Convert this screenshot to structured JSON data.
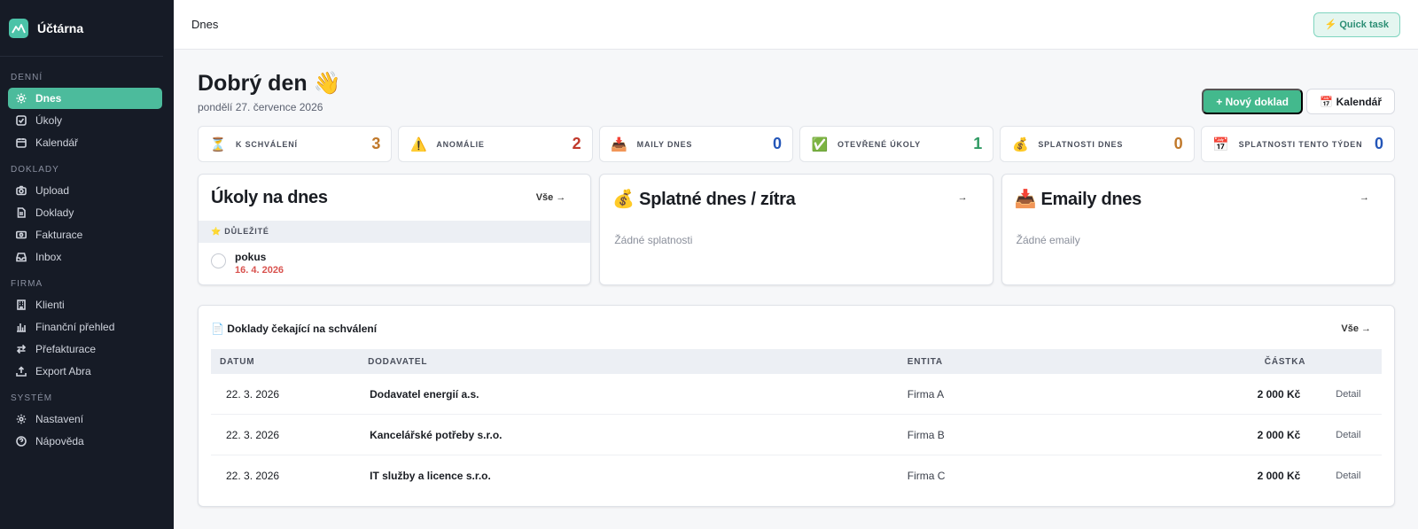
{
  "brand": {
    "name": "Účtárna",
    "color": "#4cc3a8"
  },
  "sidebar": {
    "sections": [
      {
        "title": "DENNÍ",
        "items": [
          {
            "label": "Dnes",
            "icon": "sun-icon",
            "active": true
          },
          {
            "label": "Úkoly",
            "icon": "checkbox-icon"
          },
          {
            "label": "Kalendář",
            "icon": "calendar-icon"
          }
        ]
      },
      {
        "title": "DOKLADY",
        "items": [
          {
            "label": "Upload",
            "icon": "camera-icon"
          },
          {
            "label": "Doklady",
            "icon": "document-icon"
          },
          {
            "label": "Fakturace",
            "icon": "banknote-icon"
          },
          {
            "label": "Inbox",
            "icon": "inbox-icon"
          }
        ]
      },
      {
        "title": "FIRMA",
        "items": [
          {
            "label": "Klienti",
            "icon": "building-icon"
          },
          {
            "label": "Finanční přehled",
            "icon": "bar-chart-icon"
          },
          {
            "label": "Přefakturace",
            "icon": "swap-icon"
          },
          {
            "label": "Export Abra",
            "icon": "upload-icon"
          }
        ]
      },
      {
        "title": "SYSTÉM",
        "items": [
          {
            "label": "Nastavení",
            "icon": "gear-icon"
          },
          {
            "label": "Nápověda",
            "icon": "help-icon"
          }
        ]
      }
    ]
  },
  "topbar": {
    "crumb": "Dnes",
    "quick_task": "⚡ Quick task"
  },
  "greeting": {
    "title": "Dobrý den 👋",
    "date": "pondělí 27. července 2026"
  },
  "actions": {
    "new_doc": "+ Nový doklad",
    "calendar": "📅 Kalendář"
  },
  "stats": [
    {
      "icon": "⏳",
      "label": "K SCHVÁLENÍ",
      "value": "3",
      "color": "#c0782a"
    },
    {
      "icon": "⚠️",
      "label": "ANOMÁLIE",
      "value": "2",
      "color": "#c0392b"
    },
    {
      "icon": "📥",
      "label": "MAILY DNES",
      "value": "0",
      "color": "#2456b8"
    },
    {
      "icon": "✅",
      "label": "OTEVŘENÉ ÚKOLY",
      "value": "1",
      "color": "#2f9a63"
    },
    {
      "icon": "💰",
      "label": "SPLATNOSTI DNES",
      "value": "0",
      "color": "#c0782a"
    },
    {
      "icon": "📅",
      "label": "SPLATNOSTI TENTO TÝDEN",
      "value": "0",
      "color": "#2456b8"
    }
  ],
  "tasks_card": {
    "title": "Úkoly na dnes",
    "link": "Vše →",
    "section": "⭐ DŮLEŽITÉ",
    "task": {
      "name": "pokus",
      "date": "16. 4. 2026"
    }
  },
  "due_card": {
    "title": "💰 Splatné dnes / zítra",
    "link": "→",
    "empty": "Žádné splatnosti"
  },
  "email_card": {
    "title": "📥 Emaily dnes",
    "link": "→",
    "empty": "Žádné emaily"
  },
  "approval": {
    "title": "📄 Doklady čekající na schválení",
    "link": "Vše →",
    "headers": {
      "date": "DATUM",
      "supplier": "DODAVATEL",
      "entity": "ENTITA",
      "amount": "ČÁSTKA"
    },
    "rows": [
      {
        "date": "22. 3. 2026",
        "supplier": "Dodavatel energií a.s.",
        "entity": "Firma A",
        "amount": "2 000 Kč",
        "action": "Detail"
      },
      {
        "date": "22. 3. 2026",
        "supplier": "Kancelářské potřeby s.r.o.",
        "entity": "Firma B",
        "amount": "2 000 Kč",
        "action": "Detail"
      },
      {
        "date": "22. 3. 2026",
        "supplier": "IT služby a licence s.r.o.",
        "entity": "Firma C",
        "amount": "2 000 Kč",
        "action": "Detail"
      }
    ]
  }
}
